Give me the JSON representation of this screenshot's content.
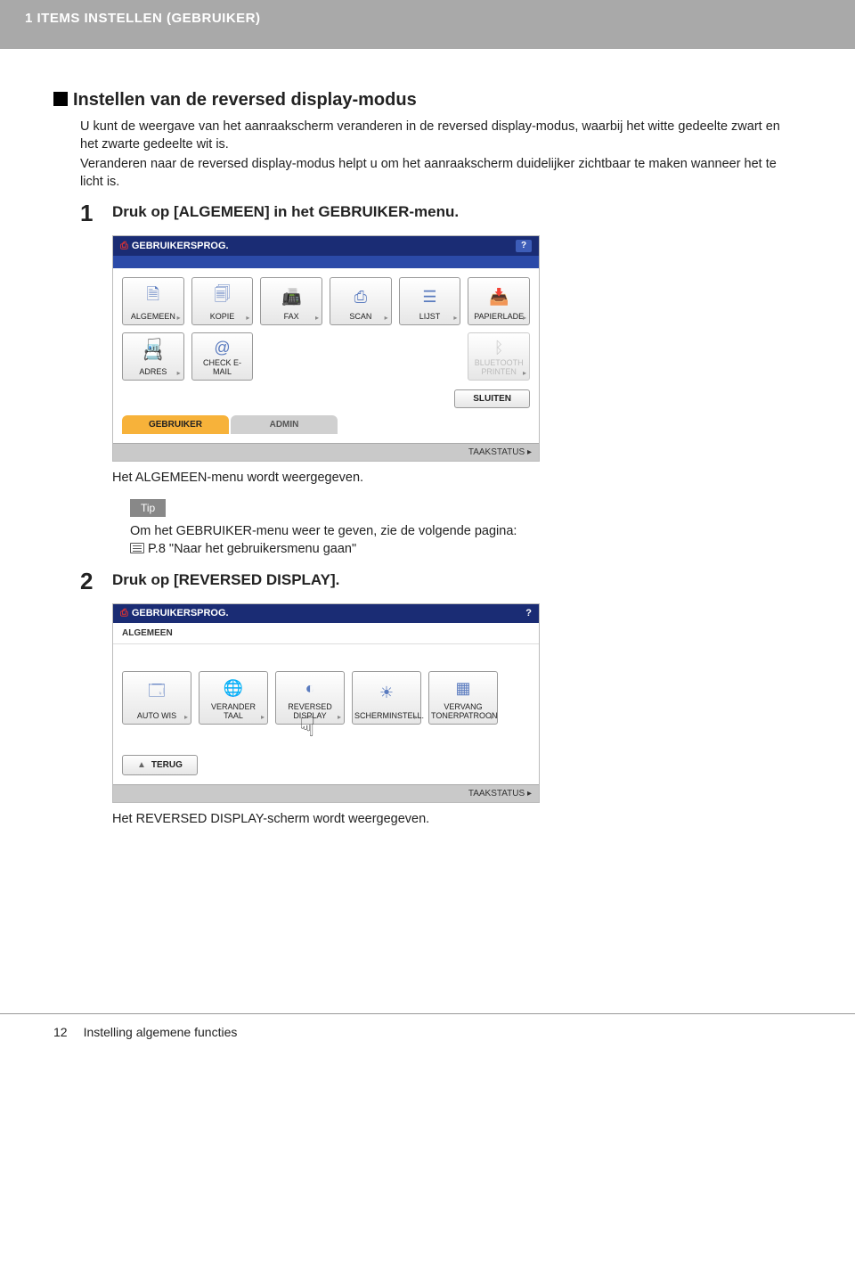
{
  "header": {
    "section_title": "1 ITEMS INSTELLEN (GEBRUIKER)"
  },
  "heading": "Instellen van de reversed display-modus",
  "intro_p1": "U kunt de weergave van het aanraakscherm veranderen in de reversed display-modus, waarbij het witte gedeelte zwart en het zwarte gedeelte wit is.",
  "intro_p2": "Veranderen naar de reversed display-modus helpt u om het aanraakscherm duidelijker zichtbaar te maken wanneer het te licht is.",
  "step1": {
    "num": "1",
    "title": "Druk op [ALGEMEEN] in het GEBRUIKER-menu.",
    "caption": "Het ALGEMEEN-menu wordt weergegeven."
  },
  "screenshot1": {
    "window_title": "GEBRUIKERSPROG.",
    "help": "?",
    "buttons": [
      "ALGEMEEN",
      "KOPIE",
      "FAX",
      "SCAN",
      "LIJST",
      "PAPIERLADE",
      "ADRES",
      "CHECK E-MAIL"
    ],
    "disabled_button": "BLUETOOTH PRINTEN",
    "close": "SLUITEN",
    "tab_active": "GEBRUIKER",
    "tab_inactive": "ADMIN",
    "status": "TAAKSTATUS"
  },
  "tip": {
    "label": "Tip",
    "line1": "Om het GEBRUIKER-menu weer te geven, zie de volgende pagina:",
    "ref": "P.8 \"Naar het gebruikersmenu gaan\""
  },
  "step2": {
    "num": "2",
    "title": "Druk op [REVERSED DISPLAY].",
    "caption": "Het REVERSED DISPLAY-scherm wordt weergegeven."
  },
  "screenshot2": {
    "window_title": "GEBRUIKERSPROG.",
    "help": "?",
    "breadcrumb": "ALGEMEEN",
    "buttons": [
      "AUTO WIS",
      "VERANDER TAAL",
      "REVERSED DISPLAY",
      "SCHERMINSTELL.",
      "VERVANG TONERPATROON"
    ],
    "back": "TERUG",
    "status": "TAAKSTATUS"
  },
  "footer": {
    "page_num": "12",
    "title": "Instelling algemene functies"
  }
}
